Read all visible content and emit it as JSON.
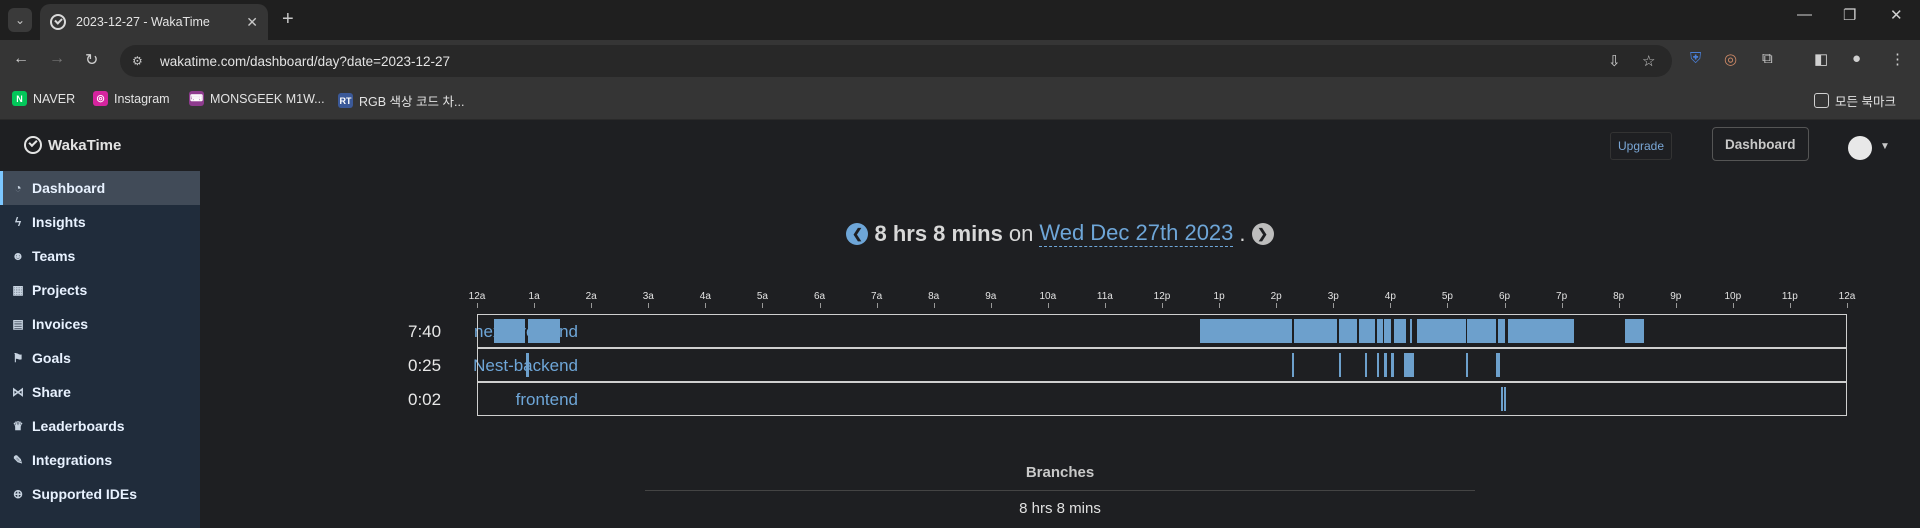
{
  "browser": {
    "tab_title": "2023-12-27 - WakaTime",
    "url": "wakatime.com/dashboard/day?date=2023-12-27",
    "bookmarks": [
      {
        "label": "NAVER",
        "icon": "naver-icon",
        "color": "#03c75a",
        "glyph": "N"
      },
      {
        "label": "Instagram",
        "icon": "instagram-icon",
        "color": "#d6249f",
        "glyph": "◎"
      },
      {
        "label": "MONSGEEK M1W...",
        "icon": "monsgeek-icon",
        "color": "#8e3b8e",
        "glyph": "⌨"
      },
      {
        "label": "RGB 색상 코드 차...",
        "icon": "rgb-icon",
        "color": "#3b5998",
        "glyph": "RT"
      }
    ],
    "all_bookmarks": "모든 북마크"
  },
  "site": {
    "brand": "WakaTime",
    "upgrade": "Upgrade",
    "dashboard_btn": "Dashboard"
  },
  "sidebar": {
    "items": [
      {
        "label": "Dashboard",
        "icon": "dashboard-icon",
        "glyph": "◔",
        "active": true
      },
      {
        "label": "Insights",
        "icon": "bolt-icon",
        "glyph": "ϟ"
      },
      {
        "label": "Teams",
        "icon": "users-icon",
        "glyph": "☻"
      },
      {
        "label": "Projects",
        "icon": "grid-icon",
        "glyph": "▦"
      },
      {
        "label": "Invoices",
        "icon": "file-icon",
        "glyph": "▤"
      },
      {
        "label": "Goals",
        "icon": "flag-icon",
        "glyph": "⚑"
      },
      {
        "label": "Share",
        "icon": "share-icon",
        "glyph": "⋈"
      },
      {
        "label": "Leaderboards",
        "icon": "trophy-icon",
        "glyph": "♛"
      },
      {
        "label": "Integrations",
        "icon": "wrench-icon",
        "glyph": "✎"
      },
      {
        "label": "Supported IDEs",
        "icon": "plus-circle-icon",
        "glyph": "⊕"
      }
    ]
  },
  "summary": {
    "total": "8 hrs 8 mins",
    "on": "on",
    "date": "Wed Dec 27th 2023",
    "period": "."
  },
  "timeline": {
    "ticks": [
      "12a",
      "1a",
      "2a",
      "3a",
      "4a",
      "5a",
      "6a",
      "7a",
      "8a",
      "9a",
      "10a",
      "11a",
      "12p",
      "1p",
      "2p",
      "3p",
      "4p",
      "5p",
      "6p",
      "7p",
      "8p",
      "9p",
      "10p",
      "11p",
      "12a"
    ],
    "projects": [
      {
        "name": "next_frontend",
        "time": "7:40",
        "segments_hours": [
          [
            0.28,
            0.83
          ],
          [
            0.88,
            1.44
          ],
          [
            12.65,
            14.26
          ],
          [
            14.3,
            15.05
          ],
          [
            15.08,
            15.4
          ],
          [
            15.43,
            15.72
          ],
          [
            15.75,
            15.85
          ],
          [
            15.88,
            16.0
          ],
          [
            16.05,
            16.25
          ],
          [
            16.32,
            16.37
          ],
          [
            16.45,
            17.3
          ],
          [
            17.33,
            17.83
          ],
          [
            17.87,
            18.0
          ],
          [
            18.05,
            19.2
          ],
          [
            20.1,
            20.42
          ]
        ]
      },
      {
        "name": "Nest-backend",
        "time": "0:25",
        "segments_hours": [
          [
            0.84,
            0.9
          ],
          [
            14.26,
            14.3
          ],
          [
            15.08,
            15.1
          ],
          [
            15.53,
            15.56
          ],
          [
            15.75,
            15.78
          ],
          [
            15.88,
            15.92
          ],
          [
            16.0,
            16.04
          ],
          [
            16.22,
            16.4
          ],
          [
            17.3,
            17.34
          ],
          [
            17.84,
            17.9
          ]
        ]
      },
      {
        "name": "frontend",
        "time": "0:02",
        "segments_hours": [
          [
            17.92,
            17.95
          ],
          [
            17.97,
            18.0
          ]
        ]
      }
    ]
  },
  "branches": {
    "title": "Branches",
    "total": "8 hrs 8 mins"
  },
  "colors": {
    "accent": "#6ea6d8",
    "segment": "#6da0cc",
    "prev_arrow": "#6ea6d8",
    "next_arrow": "#bdbdbd"
  }
}
